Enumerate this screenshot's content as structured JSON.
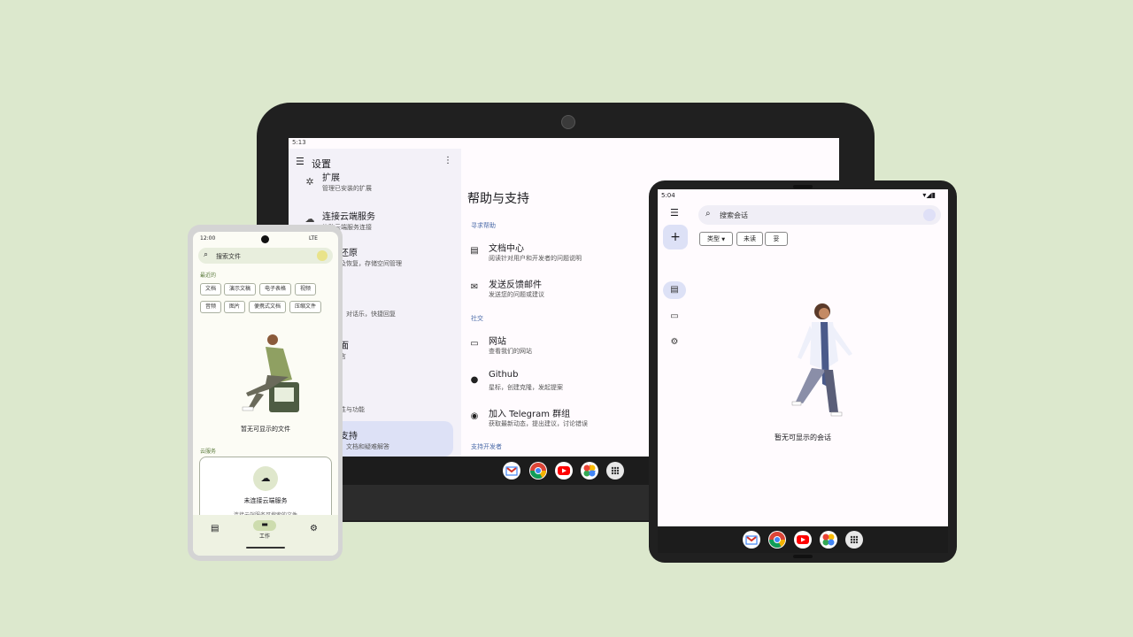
{
  "tablet": {
    "status_time": "5:13",
    "app_title": "设置",
    "settings_items": [
      {
        "title": "扩展",
        "subtitle": "管理已安装的扩展"
      },
      {
        "title": "连接云端服务",
        "subtitle": "修改云端服务连接"
      },
      {
        "title": "还原",
        "subtitle": "及恢复，存储空间管理"
      },
      {
        "title": "",
        "subtitle": "，对话乐，快捷回复"
      },
      {
        "title": "面",
        "subtitle": "言"
      },
      {
        "title": "",
        "subtitle": "性与功能"
      },
      {
        "title": "支持",
        "subtitle": "，文档和疑难解答"
      }
    ],
    "main_title": "帮助与支持",
    "sections": {
      "help": "寻求帮助",
      "social": "社交",
      "dev": "支持开发者"
    },
    "help_items": [
      {
        "title": "文档中心",
        "subtitle": "阅读针对用户和开发者的问题说明",
        "icon": "book-icon"
      },
      {
        "title": "发送反馈邮件",
        "subtitle": "发送您的问题或建议",
        "icon": "mail-icon"
      }
    ],
    "social_items": [
      {
        "title": "网站",
        "subtitle": "查看我们的网站",
        "icon": "web-icon"
      },
      {
        "title": "Github",
        "subtitle": "星标，创建克隆，发起提案",
        "icon": "github-icon"
      },
      {
        "title": "加入 Telegram 群组",
        "subtitle": "获取最新动态，提出建议，讨论错误",
        "icon": "telegram-icon"
      }
    ]
  },
  "phone": {
    "status_time": "12:00",
    "status_network": "LTE",
    "search_placeholder": "搜索文件",
    "recent_label": "最近的",
    "chips": [
      "文档",
      "演示文稿",
      "电子表格",
      "视频",
      "音频",
      "图片",
      "便携式文档",
      "压缩文件"
    ],
    "empty_text": "暂无可显示的文件",
    "cloud_label": "云服务",
    "cloud_card_title": "未连接云端服务",
    "cloud_card_sub": "连接云端服务可搜索的文件",
    "nav_work": "工作"
  },
  "right_tablet": {
    "status_time": "5:04",
    "search_placeholder": "搜索会话",
    "chips": [
      "类型",
      "未读",
      "妥"
    ],
    "empty_text": "暂无可显示的会话"
  },
  "colors": {
    "background": "#dce8cd",
    "selected_item": "#dde1f6",
    "accent": "#4a6aa8"
  }
}
